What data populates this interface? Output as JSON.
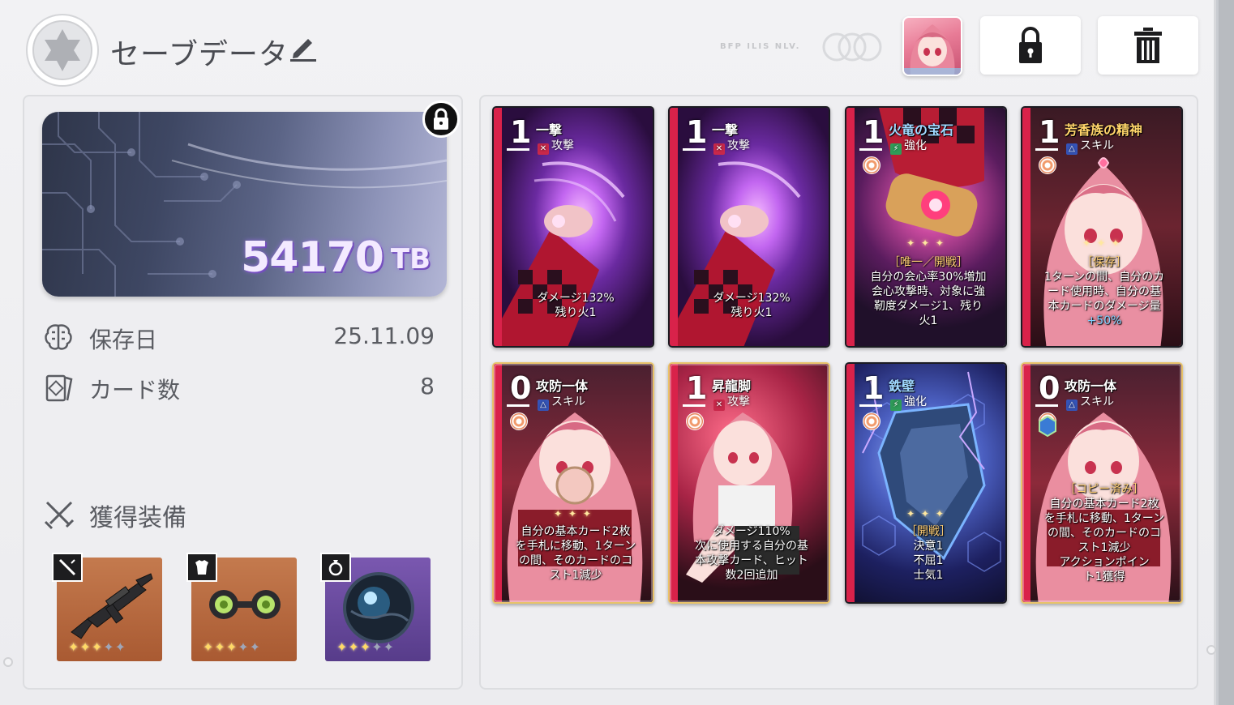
{
  "header": {
    "title": "セーブデータ",
    "faded_text": "BFP ILIS NLV.",
    "lock_icon": "lock-icon",
    "trash_icon": "trash-icon",
    "avatar": "character-avatar"
  },
  "storage": {
    "value": "54170",
    "unit": "TB"
  },
  "info": {
    "save_date_label": "保存日",
    "save_date_value": "25.11.09",
    "card_count_label": "カード数",
    "card_count_value": "8"
  },
  "equipment": {
    "title": "獲得装備",
    "items": [
      {
        "name": "rifle",
        "category_icon": "weapon-icon",
        "stars": 3,
        "max_stars": 5,
        "bg": "#b8663e"
      },
      {
        "name": "goggles",
        "category_icon": "armor-icon",
        "stars": 3,
        "max_stars": 5,
        "bg": "#b8663e"
      },
      {
        "name": "orb",
        "category_icon": "ring-icon",
        "stars": 3,
        "max_stars": 5,
        "bg": "#6a4c9c"
      }
    ]
  },
  "cards": [
    {
      "cost": "1",
      "name": "一撃",
      "type": "攻撃",
      "type_icon": "attack-icon",
      "desc_lines": [
        "ダメージ132%",
        "残り火1"
      ]
    },
    {
      "cost": "1",
      "name": "一撃",
      "type": "攻撃",
      "type_icon": "attack-icon",
      "desc_lines": [
        "ダメージ132%",
        "残り火1"
      ]
    },
    {
      "cost": "1",
      "name": "火竜の宝石",
      "type": "強化",
      "type_icon": "enhance-icon",
      "desc_lines": [
        "［唯一／開戦］",
        "自分の会心率30%増加",
        "会心攻撃時、対象に強",
        "靭度ダメージ1、残り",
        "火1"
      ]
    },
    {
      "cost": "1",
      "name": "芳香族の精神",
      "type": "スキル",
      "type_icon": "skill-icon",
      "desc_lines": [
        "［保存］",
        "1ターンの間、自分のカ",
        "ード使用時、自分の基",
        "本カードのダメージ量",
        "+50%"
      ]
    },
    {
      "cost": "0",
      "name": "攻防一体",
      "type": "スキル",
      "type_icon": "skill-icon",
      "desc_lines": [
        "自分の基本カード2枚",
        "を手札に移動、1ターン",
        "の間、そのカードのコ",
        "スト1減少"
      ]
    },
    {
      "cost": "1",
      "name": "昇龍脚",
      "type": "攻撃",
      "type_icon": "attack-icon",
      "desc_lines": [
        "ダメージ110%",
        "次に使用する自分の基",
        "本攻撃カード、ヒット",
        "数2回追加"
      ]
    },
    {
      "cost": "1",
      "name": "鉄壁",
      "type": "強化",
      "type_icon": "enhance-icon",
      "desc_lines": [
        "［開戦］",
        "決意1",
        "不屈1",
        "士気1"
      ]
    },
    {
      "cost": "0",
      "name": "攻防一体",
      "type": "スキル",
      "type_icon": "skill-icon",
      "desc_lines": [
        "［コピー済み］",
        "自分の基本カード2枚",
        "を手札に移動、1ターン",
        "の間、そのカードのコ",
        "スト1減少",
        "アクションポイン",
        "ト1獲得"
      ]
    }
  ]
}
